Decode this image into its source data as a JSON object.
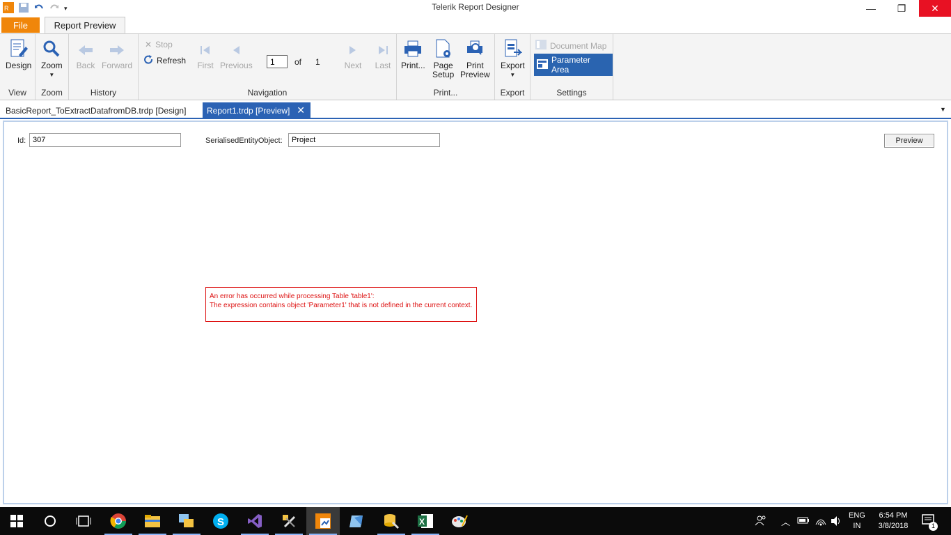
{
  "window": {
    "title": "Telerik Report Designer",
    "controls": {
      "minimize": "—",
      "restore": "❐",
      "close": "✕"
    }
  },
  "ribbon": {
    "file_tab": "File",
    "active_tab": "Report Preview",
    "groups": {
      "view": {
        "label": "View",
        "design": "Design"
      },
      "zoom": {
        "label": "Zoom",
        "zoom": "Zoom"
      },
      "history": {
        "label": "History",
        "back": "Back",
        "forward": "Forward"
      },
      "navigation": {
        "label": "Navigation",
        "stop": "Stop",
        "refresh": "Refresh",
        "first": "First",
        "previous": "Previous",
        "page_value": "1",
        "of": "of",
        "total_pages": "1",
        "next": "Next",
        "last": "Last"
      },
      "print": {
        "label": "Print...",
        "print": "Print...",
        "page_setup_1": "Page",
        "page_setup_2": "Setup",
        "print_preview_1": "Print",
        "print_preview_2": "Preview"
      },
      "export": {
        "label": "Export",
        "export": "Export"
      },
      "settings": {
        "label": "Settings",
        "document_map": "Document Map",
        "parameter_area": "Parameter Area"
      }
    }
  },
  "doc_tabs": [
    {
      "label": "BasicReport_ToExtractDatafromDB.trdp [Design]"
    },
    {
      "label": "Report1.trdp [Preview]",
      "close": "✕"
    }
  ],
  "parameters": {
    "id_label": "Id:",
    "id_value": "307",
    "entity_label": "SerialisedEntityObject:",
    "entity_value": "Project",
    "preview_button": "Preview"
  },
  "error": {
    "line1": "An error has occurred while processing Table 'table1':",
    "line2": "The expression contains object 'Parameter1' that is not defined in the current context."
  },
  "taskbar": {
    "lang_1": "ENG",
    "lang_2": "IN",
    "time": "6:54 PM",
    "date": "3/8/2018",
    "notification_count": "1"
  },
  "colors": {
    "accent_blue": "#2b62b4",
    "file_orange": "#f0860a",
    "error_red": "#dd1111",
    "close_red": "#e81123"
  }
}
